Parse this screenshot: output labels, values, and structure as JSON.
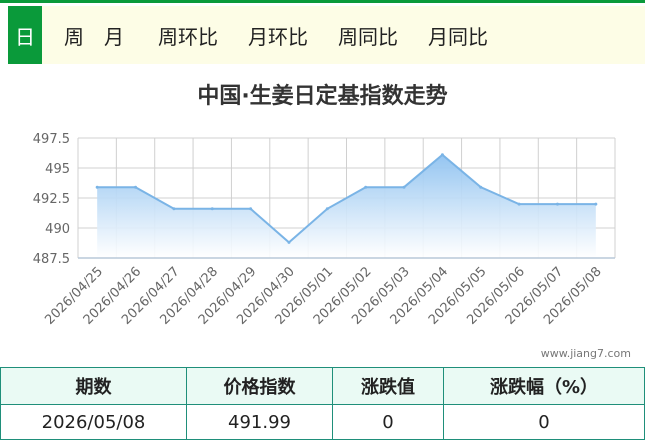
{
  "tabs": [
    {
      "label": "日",
      "active": true
    },
    {
      "label": "周"
    },
    {
      "label": "月"
    },
    {
      "label": "周环比"
    },
    {
      "label": "月环比"
    },
    {
      "label": "周同比"
    },
    {
      "label": "月同比"
    }
  ],
  "chart_data": {
    "type": "area",
    "title": "中国·生姜日定基指数走势",
    "categories": [
      "2026/04/25",
      "2026/04/26",
      "2026/04/27",
      "2026/04/28",
      "2026/04/29",
      "2026/04/30",
      "2026/05/01",
      "2026/05/02",
      "2026/05/03",
      "2026/05/04",
      "2026/05/05",
      "2026/05/06",
      "2026/05/07",
      "2026/05/08"
    ],
    "series": [
      {
        "values": [
          493.4,
          493.4,
          491.6,
          491.6,
          491.6,
          488.8,
          491.6,
          493.4,
          493.4,
          496.1,
          493.4,
          491.99,
          491.99,
          491.99
        ]
      }
    ],
    "ylim": [
      487.5,
      497.5
    ],
    "yticks": [
      "487.5",
      "490",
      "492.5",
      "495",
      "497.5"
    ],
    "grid": true,
    "colors": {
      "line": "#7ab4e6",
      "fill_top": "#8fc2f0",
      "fill_bottom": "#ffffff"
    }
  },
  "watermark": "www.jiang7.com",
  "table": {
    "headers": [
      "期数",
      "价格指数",
      "涨跌值",
      "涨跌幅（%）"
    ],
    "row": [
      "2026/05/08",
      "491.99",
      "0",
      "0"
    ]
  }
}
